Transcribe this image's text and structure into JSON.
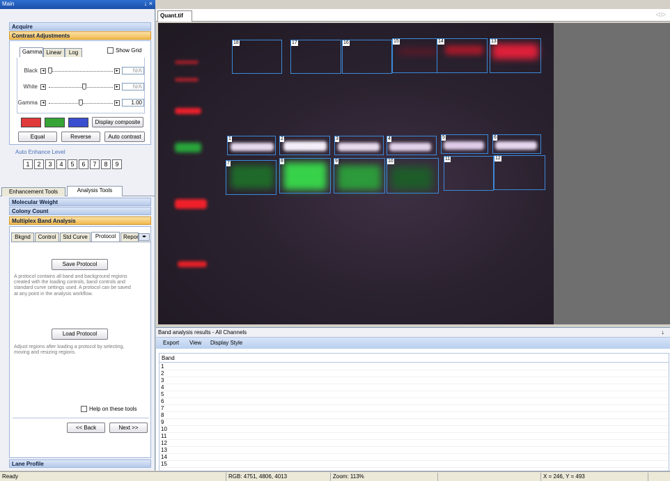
{
  "window": {
    "title": "Main",
    "controls": "↓ ×"
  },
  "sections": {
    "acquire": "Acquire",
    "contrast": "Contrast Adjustments",
    "molecular_weight": "Molecular Weight",
    "colony_count": "Colony Count",
    "multiplex": "Multiplex Band Analysis",
    "lane_profile": "Lane Profile"
  },
  "contrast": {
    "tabs": [
      "Gamma",
      "Linear",
      "Log"
    ],
    "show_grid": "Show Grid",
    "rows": [
      {
        "label": "Black",
        "value": "N/A",
        "position": 0.02
      },
      {
        "label": "White",
        "value": "N/A",
        "position": 0.55
      },
      {
        "label": "Gamma",
        "value": "1.00",
        "position": 0.5
      }
    ],
    "swatch_colors": [
      "#e03a3a",
      "#37a437",
      "#3a4fd0"
    ],
    "display_composite": "Display composite",
    "equal": "Equal",
    "reverse": "Reverse",
    "auto_contrast": "Auto contrast",
    "auto_enhance_label": "Auto Enhance Level",
    "levels": [
      "1",
      "2",
      "3",
      "4",
      "5",
      "6",
      "7",
      "8",
      "9"
    ]
  },
  "tool_tabs": [
    "Enhancement Tools",
    "Analysis Tools"
  ],
  "multiplex": {
    "tabs": [
      "Bkgnd",
      "Control",
      "Std Curve",
      "Protocol",
      "Repor"
    ],
    "save_protocol": "Save Protocol",
    "save_desc": "A protocol contains all band and background regions created with the loading controls, band controls and standard curve settings used. A protocol can be saved at any point in the analysis workflow.",
    "load_protocol": "Load Protocol",
    "load_desc": "Adjust regions after loading a protocol by selecting, moving and resizing regions.",
    "help": "Help on these tools",
    "back": "<< Back",
    "next": "Next >>"
  },
  "document": {
    "tab": "Quant.tif",
    "nav": "◁ ▷"
  },
  "rois": [
    {
      "label": "18"
    },
    {
      "label": "17"
    },
    {
      "label": "16"
    },
    {
      "label": "15"
    },
    {
      "label": "14"
    },
    {
      "label": "13"
    },
    {
      "label": "1"
    },
    {
      "label": "2"
    },
    {
      "label": "3"
    },
    {
      "label": "4"
    },
    {
      "label": "5"
    },
    {
      "label": "6"
    },
    {
      "label": "7"
    },
    {
      "label": "8"
    },
    {
      "label": "9"
    },
    {
      "label": "10"
    },
    {
      "label": "11"
    },
    {
      "label": "12"
    }
  ],
  "results": {
    "title": "Band analysis results - All Channels",
    "pin": "↓",
    "menu": [
      "Export",
      "View",
      "Display Style"
    ],
    "column": "Band",
    "rows": [
      "1",
      "2",
      "3",
      "4",
      "5",
      "6",
      "7",
      "8",
      "9",
      "10",
      "11",
      "12",
      "13",
      "14",
      "15"
    ]
  },
  "status": {
    "ready": "Ready",
    "rgb": "RGB: 4751, 4806, 4013",
    "zoom": "Zoom: 113%",
    "coords": "X = 246, Y = 493"
  }
}
